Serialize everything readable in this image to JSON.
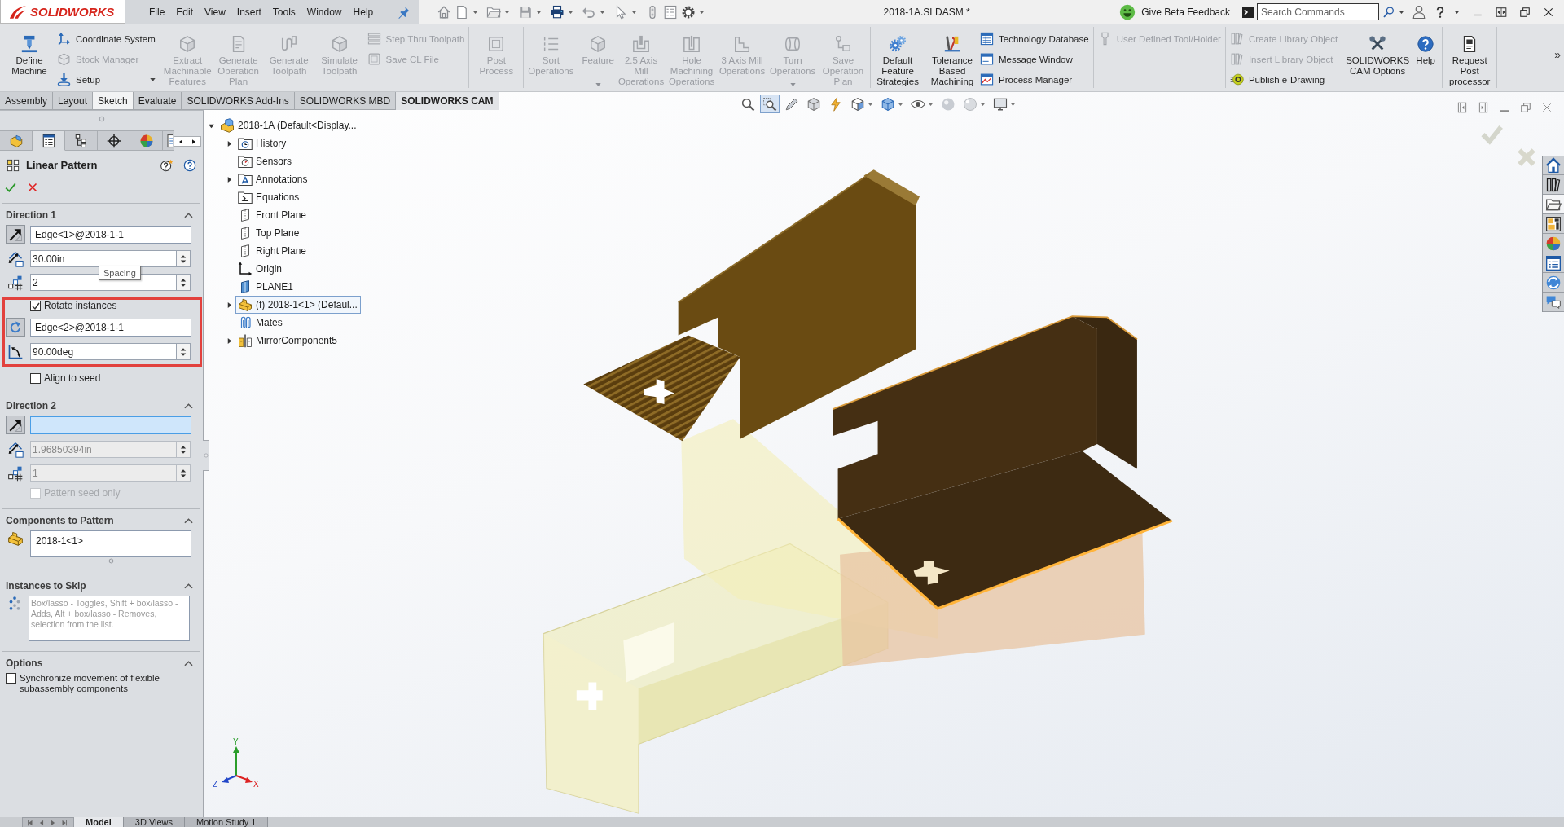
{
  "menu_bar": {
    "logo": "SOLIDWORKS",
    "menus": [
      "File",
      "Edit",
      "View",
      "Insert",
      "Tools",
      "Window",
      "Help"
    ],
    "document_title": "2018-1A.SLDASM *",
    "feedback": "Give Beta Feedback",
    "search": {
      "placeholder": "Search Commands"
    }
  },
  "command_manager": {
    "groups": [
      [
        {
          "kind": "large",
          "label": "Define Machine",
          "disabled": false,
          "dropdown": false
        },
        {
          "kind": "stack",
          "items": [
            {
              "label": "Coordinate System",
              "disabled": false,
              "dropdown": false
            },
            {
              "label": "Stock Manager",
              "disabled": true,
              "dropdown": false
            },
            {
              "label": "Setup",
              "disabled": false,
              "dropdown": true
            }
          ]
        }
      ],
      [
        {
          "kind": "large",
          "label": "Extract Machinable Features",
          "disabled": true,
          "dropdown": false
        },
        {
          "kind": "large",
          "label": "Generate Operation Plan",
          "disabled": true,
          "dropdown": false
        },
        {
          "kind": "large",
          "label": "Generate Toolpath",
          "disabled": true,
          "dropdown": false
        },
        {
          "kind": "large",
          "label": "Simulate Toolpath",
          "disabled": true,
          "dropdown": false
        },
        {
          "kind": "stack",
          "items": [
            {
              "label": "Step Thru Toolpath",
              "disabled": true,
              "dropdown": false
            },
            {
              "label": "Save CL File",
              "disabled": true,
              "dropdown": false
            }
          ]
        }
      ],
      [
        {
          "kind": "large",
          "label": "Post Process",
          "disabled": true,
          "dropdown": false
        }
      ],
      [
        {
          "kind": "large",
          "label": "Sort Operations",
          "disabled": true,
          "dropdown": false
        }
      ],
      [
        {
          "kind": "large",
          "label": "Feature",
          "disabled": true,
          "dropdown": true
        },
        {
          "kind": "large",
          "label": "2.5 Axis Mill Operations",
          "disabled": true,
          "dropdown": false
        },
        {
          "kind": "large",
          "label": "Hole Machining Operations",
          "disabled": true,
          "dropdown": false
        },
        {
          "kind": "large",
          "label": "3 Axis Mill Operations",
          "disabled": true,
          "dropdown": false
        },
        {
          "kind": "large",
          "label": "Turn Operations",
          "disabled": true,
          "dropdown": true
        },
        {
          "kind": "large",
          "label": "Save Operation Plan",
          "disabled": true,
          "dropdown": false
        }
      ],
      [
        {
          "kind": "large",
          "label": "Default Feature Strategies",
          "disabled": false,
          "dropdown": false
        }
      ],
      [
        {
          "kind": "large",
          "label": "Tolerance Based Machining",
          "disabled": false,
          "dropdown": false
        },
        {
          "kind": "stack",
          "items": [
            {
              "label": "Technology Database",
              "disabled": false,
              "dropdown": false
            },
            {
              "label": "Message Window",
              "disabled": false,
              "dropdown": false
            },
            {
              "label": "Process Manager",
              "disabled": false,
              "dropdown": false
            }
          ]
        }
      ],
      [
        {
          "kind": "stack",
          "items": [
            {
              "label": "User Defined Tool/Holder",
              "disabled": true,
              "dropdown": false
            }
          ]
        }
      ],
      [
        {
          "kind": "stack",
          "items": [
            {
              "label": "Create Library Object",
              "disabled": true,
              "dropdown": false
            },
            {
              "label": "Insert Library Object",
              "disabled": true,
              "dropdown": false
            },
            {
              "label": "Publish e-Drawing",
              "disabled": false,
              "dropdown": false
            }
          ]
        }
      ],
      [
        {
          "kind": "large",
          "label": "SOLIDWORKS CAM Options",
          "disabled": false,
          "dropdown": false
        },
        {
          "kind": "large",
          "label": "Help",
          "disabled": false,
          "dropdown": false
        }
      ],
      [
        {
          "kind": "large",
          "label": "Request Post processor",
          "disabled": false,
          "dropdown": false
        }
      ]
    ],
    "more": "»"
  },
  "ribbon_tabs": [
    {
      "label": "Assembly",
      "selected": false,
      "hovered": false
    },
    {
      "label": "Layout",
      "selected": false,
      "hovered": false
    },
    {
      "label": "Sketch",
      "selected": false,
      "hovered": true
    },
    {
      "label": "Evaluate",
      "selected": false,
      "hovered": false
    },
    {
      "label": "SOLIDWORKS Add-Ins",
      "selected": false,
      "hovered": false
    },
    {
      "label": "SOLIDWORKS MBD",
      "selected": false,
      "hovered": false
    },
    {
      "label": "SOLIDWORKS CAM",
      "selected": true,
      "hovered": false
    }
  ],
  "view_toolbar": [
    {
      "selected": false,
      "dropdown": false
    },
    {
      "selected": true,
      "dropdown": false
    },
    {
      "selected": false,
      "dropdown": false
    },
    {
      "selected": false,
      "dropdown": false
    },
    {
      "selected": false,
      "dropdown": false
    },
    {
      "selected": false,
      "dropdown": true
    },
    {
      "selected": false,
      "dropdown": true
    },
    {
      "selected": false,
      "dropdown": true
    },
    {
      "selected": false,
      "dropdown": false
    },
    {
      "selected": false,
      "dropdown": true
    },
    {
      "selected": false,
      "dropdown": true
    }
  ],
  "property_manager": {
    "tabs": [
      {
        "selected": false
      },
      {
        "selected": true
      },
      {
        "selected": false
      },
      {
        "selected": false
      },
      {
        "selected": false
      },
      {
        "selected": false
      }
    ],
    "title": "Linear Pattern",
    "sections": [
      {
        "title": "Direction 1",
        "expanded": true,
        "rows": [
          {
            "kind": "direction",
            "value": "Edge<1>@2018-1-1",
            "active": false
          },
          {
            "kind": "spacing",
            "value": "30.00in",
            "disabled": false,
            "tooltip": "Spacing"
          },
          {
            "kind": "count",
            "value": "2",
            "disabled": false
          },
          {
            "kind": "highlight",
            "rows": [
              {
                "kind": "checkbox",
                "label": "Rotate instances",
                "checked": true,
                "disabled": false
              },
              {
                "kind": "axis",
                "value": "Edge<2>@2018-1-1",
                "active": false
              },
              {
                "kind": "angle",
                "value": "90.00deg",
                "disabled": false
              }
            ]
          },
          {
            "kind": "checkbox",
            "label": "Align to seed",
            "checked": false,
            "disabled": false
          }
        ]
      },
      {
        "title": "Direction 2",
        "expanded": true,
        "rows": [
          {
            "kind": "direction",
            "active": true
          },
          {
            "kind": "spacing",
            "value": "1.96850394in",
            "disabled": true
          },
          {
            "kind": "count",
            "value": "1",
            "disabled": true
          },
          {
            "kind": "checkbox",
            "label": "Pattern seed only",
            "checked": false,
            "disabled": true
          }
        ]
      },
      {
        "title": "Components to Pattern",
        "expanded": true,
        "rows": [
          {
            "kind": "components",
            "items": [
              "2018-1<1>"
            ]
          }
        ]
      },
      {
        "title": "Instances to Skip",
        "expanded": true,
        "rows": [
          {
            "kind": "skip-list",
            "placeholder": "Box/lasso - Toggles, Shift + box/lasso - Adds, Alt + box/lasso - Removes, selection from the list."
          }
        ]
      },
      {
        "title": "Options",
        "expanded": true,
        "rows": [
          {
            "kind": "checkbox",
            "label": "Synchronize movement of flexible subassembly components",
            "checked": false,
            "disabled": false
          }
        ]
      }
    ]
  },
  "feature_tree": {
    "root": {
      "label": "2018-1A (Default<Display...",
      "expanded": true,
      "children": [
        {
          "kind": "history",
          "label": "History",
          "expandable": true,
          "selected": false
        },
        {
          "kind": "sensors",
          "label": "Sensors",
          "expandable": false,
          "selected": false
        },
        {
          "kind": "annotations",
          "label": "Annotations",
          "expandable": true,
          "selected": false
        },
        {
          "kind": "equations",
          "label": "Equations",
          "expandable": false,
          "selected": false
        },
        {
          "kind": "plane",
          "label": "Front Plane",
          "expandable": false,
          "selected": false
        },
        {
          "kind": "plane",
          "label": "Top Plane",
          "expandable": false,
          "selected": false
        },
        {
          "kind": "plane",
          "label": "Right Plane",
          "expandable": false,
          "selected": false
        },
        {
          "kind": "origin",
          "label": "Origin",
          "expandable": false,
          "selected": false
        },
        {
          "kind": "ref-plane",
          "label": "PLANE1",
          "expandable": false,
          "selected": false
        },
        {
          "kind": "component",
          "label": "(f) 2018-1<1> (Defaul...",
          "expandable": true,
          "selected": true
        },
        {
          "kind": "mates",
          "label": "Mates",
          "expandable": false,
          "selected": false
        },
        {
          "kind": "mirror",
          "label": "MirrorComponent5",
          "expandable": true,
          "selected": false
        }
      ]
    }
  },
  "task_pane": [
    {
      "selected": false
    },
    {
      "selected": false
    },
    {
      "selected": true
    },
    {
      "selected": false
    },
    {
      "selected": false
    },
    {
      "selected": false
    },
    {
      "selected": false
    },
    {
      "selected": false
    }
  ],
  "triad": {
    "y": "Y",
    "x": "X",
    "z": "Z"
  },
  "bottom_tabs": [
    {
      "label": "Model",
      "selected": true
    },
    {
      "label": "3D Views",
      "selected": false
    },
    {
      "label": "Motion Study 1",
      "selected": false
    }
  ]
}
